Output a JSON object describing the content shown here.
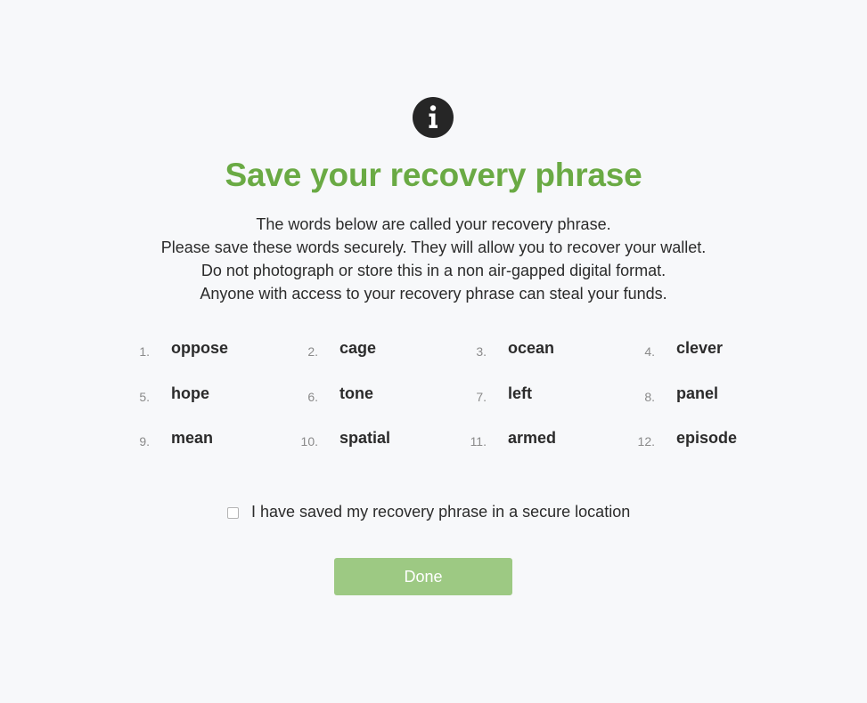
{
  "header": {
    "icon": "info-icon",
    "title": "Save your recovery phrase"
  },
  "description": [
    "The words below are called your recovery phrase.",
    "Please save these words securely. They will allow you to recover your wallet.",
    "Do not photograph or store this in a non air-gapped digital format.",
    "Anyone with access to your recovery phrase can steal your funds."
  ],
  "words": [
    {
      "num": "1.",
      "word": "oppose"
    },
    {
      "num": "2.",
      "word": "cage"
    },
    {
      "num": "3.",
      "word": "ocean"
    },
    {
      "num": "4.",
      "word": "clever"
    },
    {
      "num": "5.",
      "word": "hope"
    },
    {
      "num": "6.",
      "word": "tone"
    },
    {
      "num": "7.",
      "word": "left"
    },
    {
      "num": "8.",
      "word": "panel"
    },
    {
      "num": "9.",
      "word": "mean"
    },
    {
      "num": "10.",
      "word": "spatial"
    },
    {
      "num": "11.",
      "word": "armed"
    },
    {
      "num": "12.",
      "word": "episode"
    }
  ],
  "confirm": {
    "checked": false,
    "label": "I have saved my recovery phrase in a secure location"
  },
  "done_button": {
    "label": "Done",
    "enabled": false
  },
  "colors": {
    "background": "#f7f8fa",
    "title": "#6aaa44",
    "button": "#9dc983",
    "icon": "#262626"
  }
}
